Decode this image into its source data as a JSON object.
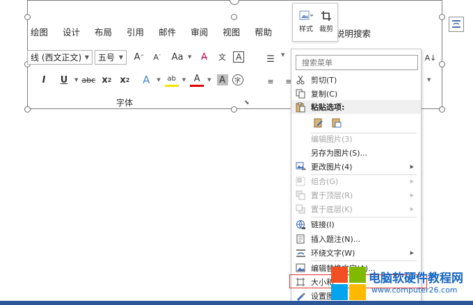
{
  "ribbon": {
    "tabs": [
      "绘图",
      "设计",
      "布局",
      "引用",
      "邮件",
      "审阅",
      "视图",
      "帮助"
    ],
    "tell_me": "说明搜索",
    "font_name": "线 (西文正文)",
    "font_size": "五号",
    "font_group_label": "字体"
  },
  "mini_toolbar": {
    "style_label": "样式",
    "crop_label": "裁剪"
  },
  "context_menu": {
    "search_placeholder": "搜索菜单",
    "items": [
      {
        "label": "剪切(T)",
        "icon": "scissors-icon",
        "enabled": true
      },
      {
        "label": "复制(C)",
        "icon": "copy-icon",
        "enabled": true
      },
      {
        "label": "粘贴选项:",
        "icon": "paste-icon",
        "enabled": true
      },
      {
        "label": "编辑图片(3)",
        "icon": "",
        "enabled": false
      },
      {
        "label": "另存为图片(S)...",
        "icon": "",
        "enabled": true
      },
      {
        "label": "更改图片(4)",
        "icon": "change-picture-icon",
        "enabled": true,
        "submenu": true
      },
      {
        "label": "组合(G)",
        "icon": "group-icon",
        "enabled": false,
        "submenu": true
      },
      {
        "label": "置于顶层(R)",
        "icon": "bring-front-icon",
        "enabled": false,
        "submenu": true
      },
      {
        "label": "置于底层(K)",
        "icon": "send-back-icon",
        "enabled": false,
        "submenu": true
      },
      {
        "label": "链接(I)",
        "icon": "link-icon",
        "enabled": true
      },
      {
        "label": "插入题注(N)...",
        "icon": "caption-icon",
        "enabled": true
      },
      {
        "label": "环绕文字(W)",
        "icon": "wrap-text-icon",
        "enabled": true,
        "submenu": true
      },
      {
        "label": "编辑替换文字(A)...",
        "icon": "alt-text-icon",
        "enabled": true
      },
      {
        "label": "大小和",
        "icon": "size-icon",
        "enabled": true
      },
      {
        "label": "设置图",
        "icon": "format-picture-icon",
        "enabled": true
      }
    ]
  },
  "watermark": {
    "title": "电脑软硬件教程网",
    "url": "www.computer26.com"
  },
  "colors": {
    "accent_blue": "#2b579a",
    "highlight_red": "#d9302a",
    "watermark_blue": "#1565c0"
  }
}
